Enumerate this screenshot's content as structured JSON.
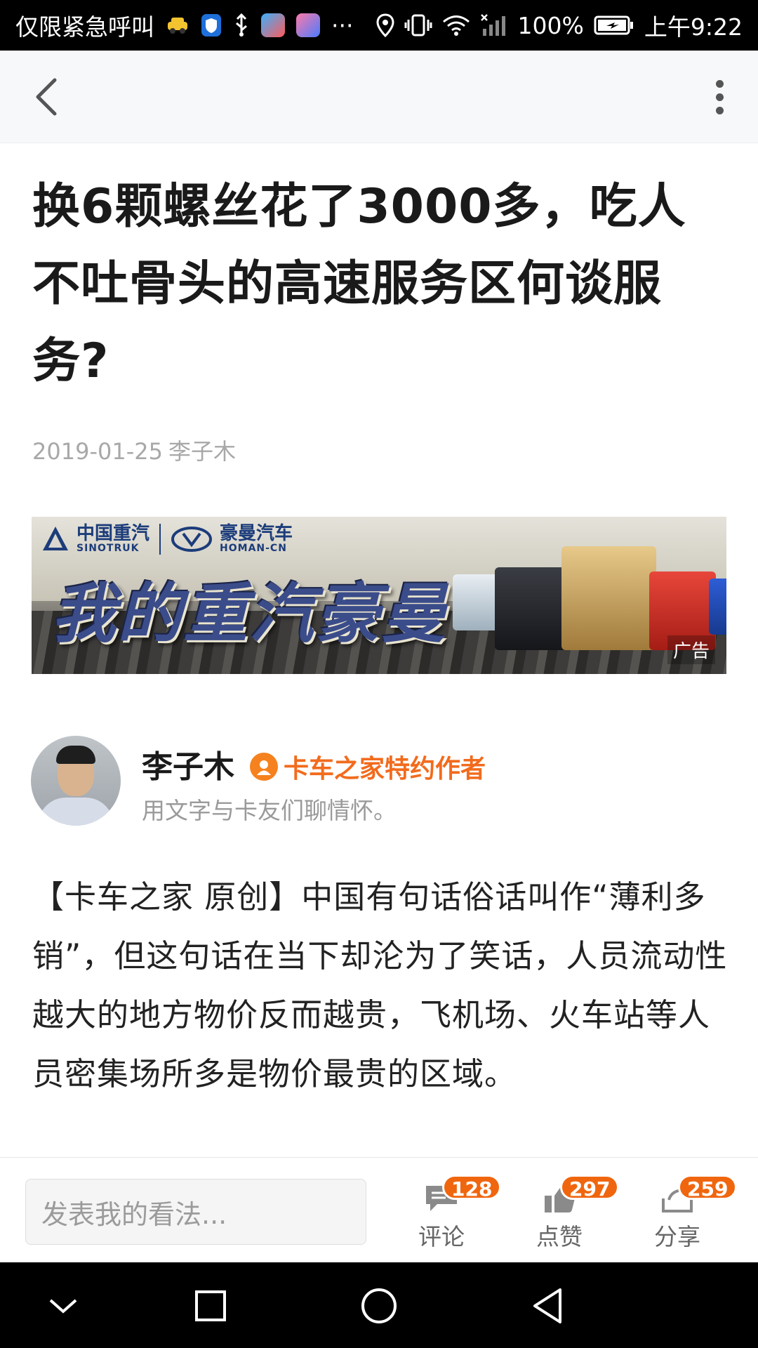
{
  "status_bar": {
    "left_text": "仅限紧急呼叫",
    "more": "···",
    "battery": "100%",
    "time": "上午9:22"
  },
  "article": {
    "title": "换6颗螺丝花了3000多，吃人不吐骨头的高速服务区何谈服务?",
    "date": "2019-01-25",
    "author_inline": "李子木"
  },
  "ad": {
    "brand1_cn": "中国重汽",
    "brand1_en": "SINOTRUK",
    "brand2_cn": "豪曼汽车",
    "brand2_en": "HOMAN-CN",
    "slogan": "我的重汽豪曼",
    "tag": "广告"
  },
  "author": {
    "name": "李子木",
    "badge": "卡车之家特约作者",
    "bio": "用文字与卡友们聊情怀。"
  },
  "body": {
    "paragraph": "【卡车之家 原创】中国有句话俗话叫作“薄利多销”，但这句话在当下却沦为了笑话，人员流动性越大的地方物价反而越贵，飞机场、火车站等人员密集场所多是物价最贵的区域。"
  },
  "actions": {
    "comment_placeholder": "发表我的看法...",
    "comment": {
      "label": "评论",
      "count": "128"
    },
    "like": {
      "label": "点赞",
      "count": "297"
    },
    "share": {
      "label": "分享",
      "count": "259"
    }
  },
  "colors": {
    "accent": "#f0660f",
    "badge_text": "#f26b1d"
  }
}
